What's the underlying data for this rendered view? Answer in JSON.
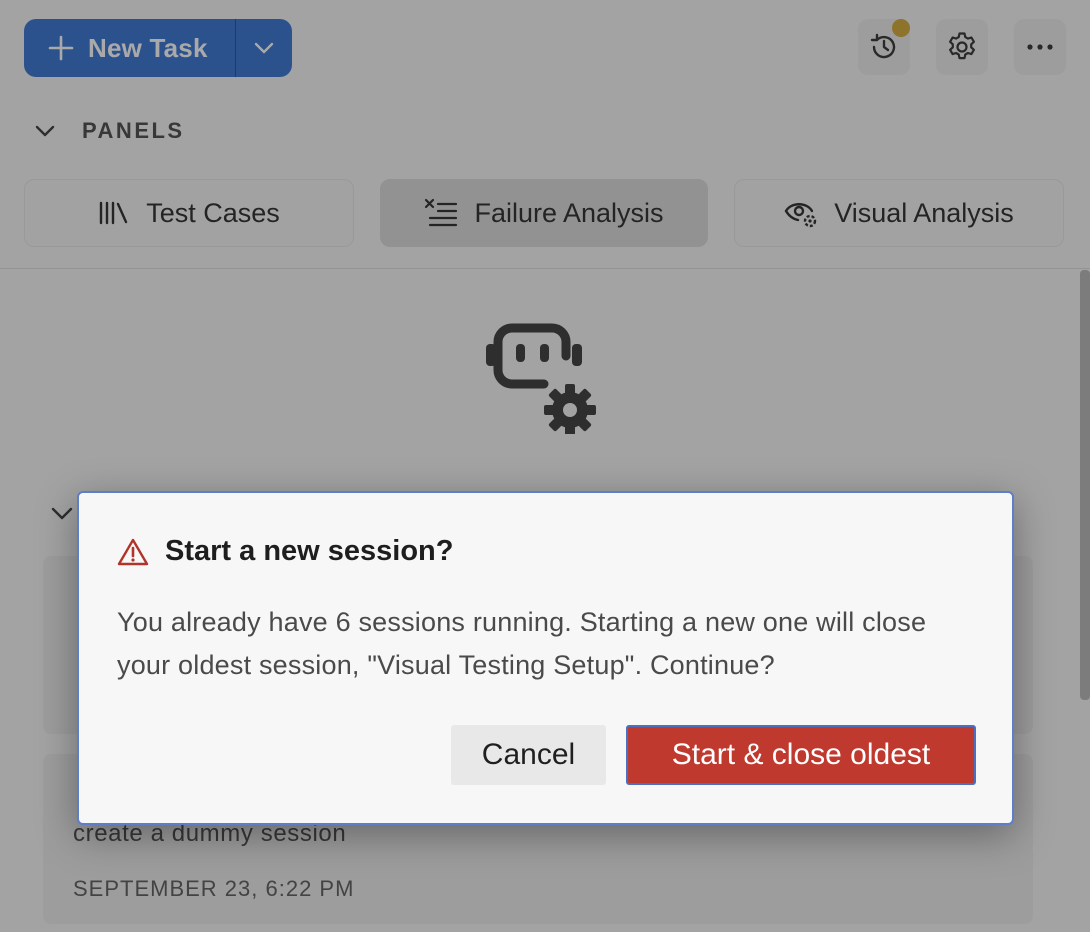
{
  "toolbar": {
    "new_task_label": "New Task"
  },
  "panels": {
    "header": "PANELS",
    "tabs": [
      {
        "label": "Test Cases",
        "icon": "library-icon"
      },
      {
        "label": "Failure Analysis",
        "icon": "list-x-icon"
      },
      {
        "label": "Visual Analysis",
        "icon": "eye-gear-icon"
      }
    ],
    "active_tab": "Failure Analysis"
  },
  "sessions": [
    {
      "title": "",
      "description": "",
      "date": ""
    },
    {
      "title": "",
      "description": "create a dummy session",
      "date": "SEPTEMBER 23, 6:22 PM"
    }
  ],
  "dialog": {
    "title": "Start a new session?",
    "body": "You already have 6 sessions running. Starting a new one will close your oldest session, \"Visual Testing Setup\". Continue?",
    "cancel_label": "Cancel",
    "confirm_label": "Start & close oldest"
  },
  "colors": {
    "primary": "#2f6fd1",
    "danger": "#c0392f",
    "notification": "#d1a530",
    "warning_icon": "#b0342a"
  }
}
